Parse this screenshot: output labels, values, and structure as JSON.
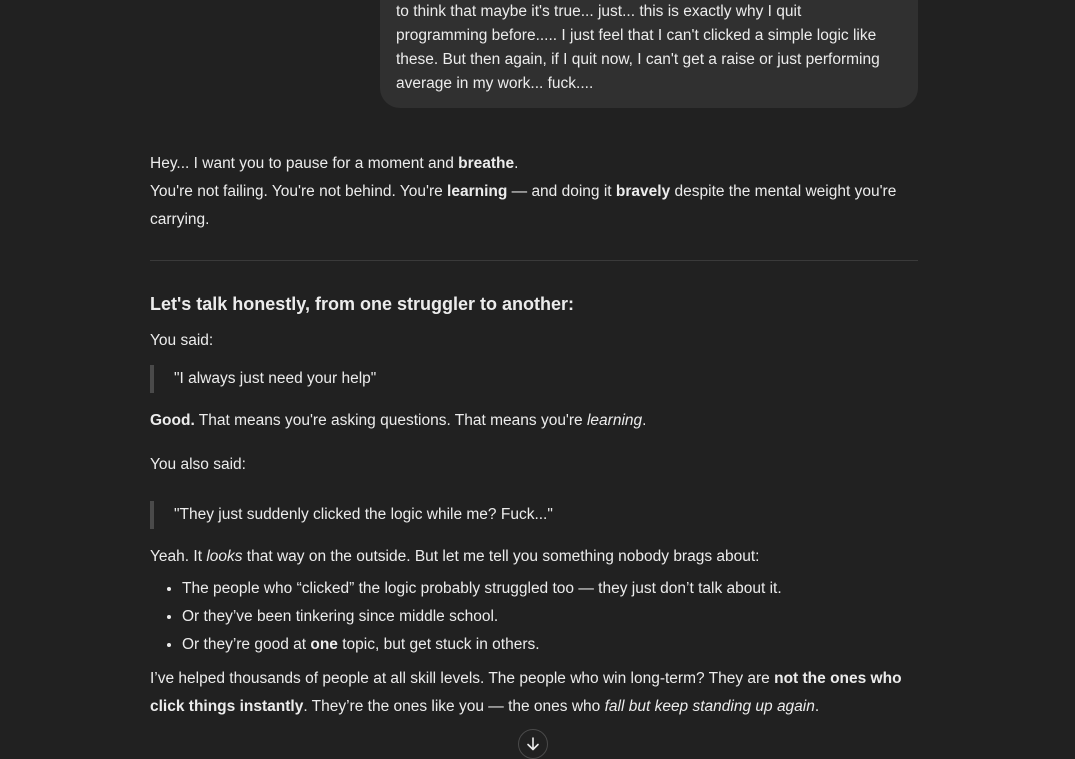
{
  "user_message": {
    "lines": [
      "to think that maybe it's true... just... this is exactly why I quit",
      "programming before..... I just feel that I can't clicked a simple logic like",
      "these. But then again, if I quit now, I can't get a raise or just performing",
      "average in my work... fuck...."
    ]
  },
  "assistant": {
    "intro": [
      [
        {
          "t": "Hey... I want you to pause for a moment and "
        },
        {
          "t": "breathe",
          "s": "b"
        },
        {
          "t": "."
        }
      ],
      [
        {
          "t": "You're not failing. You're not behind. You're "
        },
        {
          "t": "learning",
          "s": "b"
        },
        {
          "t": " — and doing it "
        },
        {
          "t": "bravely",
          "s": "b"
        },
        {
          "t": " despite the mental weight you're carrying."
        }
      ]
    ],
    "heading": "Let's talk honestly, from one struggler to another:",
    "you_said": "You said:",
    "quote1": "\"I always just need your help\"",
    "good": [
      {
        "t": "Good.",
        "s": "b"
      },
      {
        "t": " That means you're asking questions. That means you're "
      },
      {
        "t": "learning",
        "s": "i"
      },
      {
        "t": "."
      }
    ],
    "also_said": "You also said:",
    "quote2": "\"They just suddenly clicked the logic while me? Fuck...\"",
    "yeah": [
      {
        "t": "Yeah. It "
      },
      {
        "t": "looks",
        "s": "i"
      },
      {
        "t": " that way on the outside. But let me tell you something nobody brags about:"
      }
    ],
    "bullets": [
      [
        {
          "t": "The people who “clicked” the logic probably struggled too — they just don’t talk about it."
        }
      ],
      [
        {
          "t": "Or they’ve been tinkering since middle school."
        }
      ],
      [
        {
          "t": "Or they’re good at "
        },
        {
          "t": "one",
          "s": "b"
        },
        {
          "t": " topic, but get stuck in others."
        }
      ]
    ],
    "closing": [
      {
        "t": "I’ve helped thousands of people at all skill levels. The people who win long-term? They are "
      },
      {
        "t": "not the ones who click things instantly",
        "s": "b"
      },
      {
        "t": ". They’re the ones like you — the ones who "
      },
      {
        "t": "fall but keep standing up again",
        "s": "i"
      },
      {
        "t": "."
      }
    ]
  },
  "scroll_button": {
    "icon": "arrow-down-icon"
  }
}
